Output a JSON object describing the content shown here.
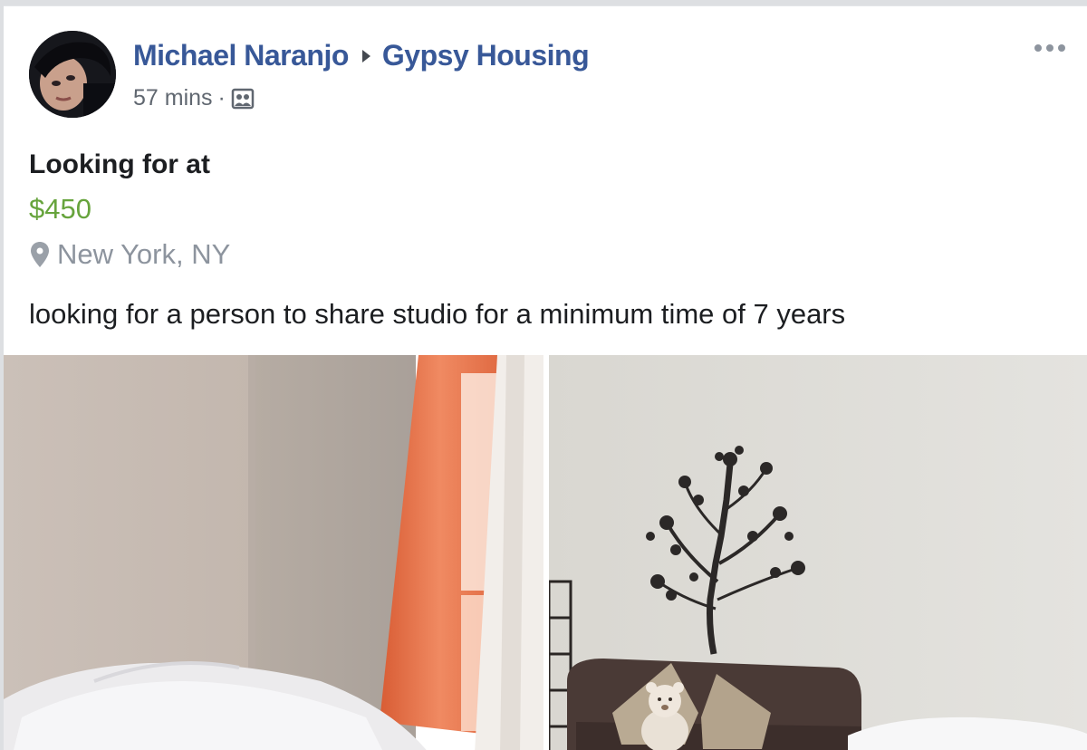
{
  "post": {
    "author": "Michael Naranjo",
    "group": "Gypsy Housing",
    "time": "57 mins",
    "separator": "·",
    "title": "Looking for at",
    "price": "$450",
    "location": "New York, NY",
    "body": "looking for a person to share studio for a minimum time of 7 years"
  },
  "icons": {
    "audience": "group-photo-icon",
    "location": "map-pin-icon",
    "more": "more-options-icon",
    "arrow": "triangle-right-icon"
  },
  "colors": {
    "link": "#385898",
    "price": "#67a43d",
    "muted": "#8d949e",
    "text": "#1c1e21"
  }
}
